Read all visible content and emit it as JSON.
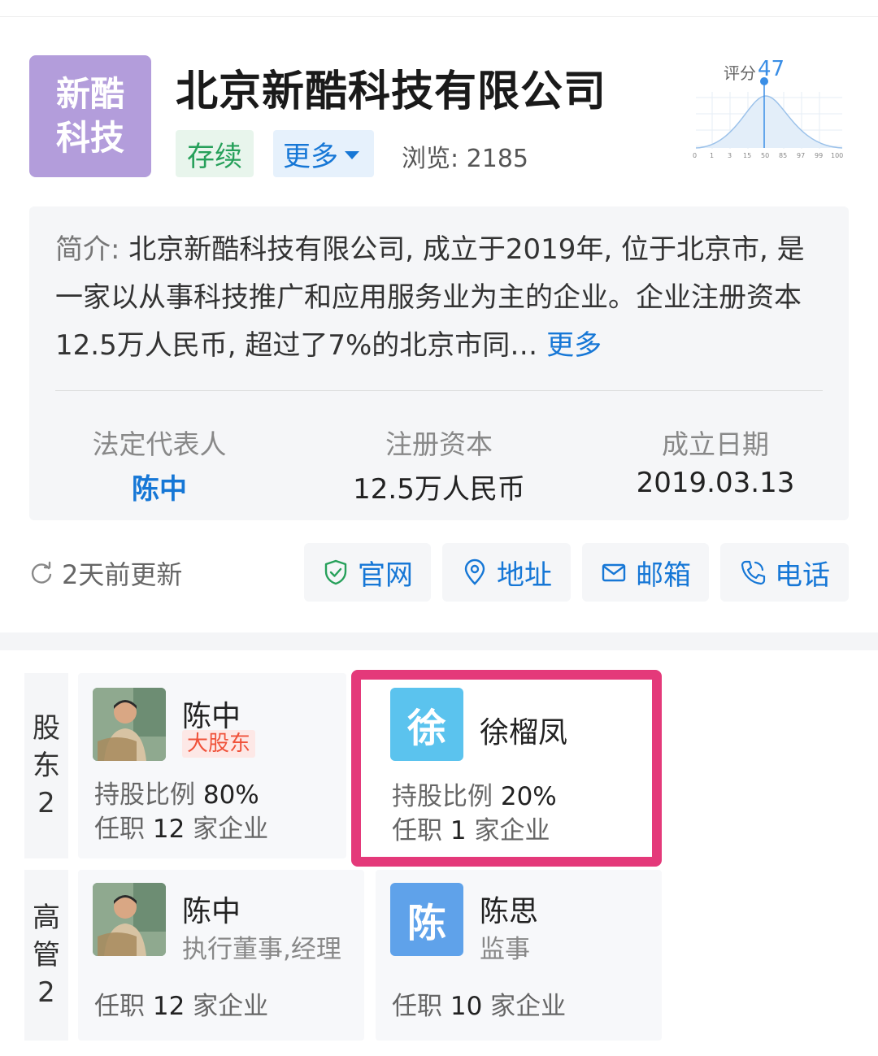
{
  "header": {
    "logo_lines": [
      "新酷",
      "科技"
    ],
    "company_name": "北京新酷科技有限公司",
    "status_tag": "存续",
    "more_label": "更多",
    "views": "浏览: 2185",
    "score_label": "评分",
    "score_value": "47",
    "score_axis": [
      "0",
      "1",
      "3",
      "15",
      "50",
      "85",
      "97",
      "99",
      "100"
    ]
  },
  "intro": {
    "label": "简介:",
    "text": "北京新酷科技有限公司, 成立于2019年, 位于北京市, 是一家以从事科技推广和应用服务业为主的企业。企业注册资本12.5万人民币, 超过了7%的北京市同…",
    "more": "更多",
    "legal_rep_label": "法定代表人",
    "legal_rep_value": "陈中",
    "capital_label": "注册资本",
    "capital_value": "12.5万人民币",
    "date_label": "成立日期",
    "date_value": "2019.03.13"
  },
  "actions": {
    "update": "2天前更新",
    "website": "官网",
    "address": "地址",
    "email": "邮箱",
    "phone": "电话"
  },
  "shareholders": {
    "label_chars": [
      "股",
      "东",
      "2"
    ],
    "items": [
      {
        "name": "陈中",
        "badge": "大股东",
        "ratio_label": "持股比例",
        "ratio": "80%",
        "jobs_prefix": "任职",
        "jobs": "12",
        "jobs_suffix": "家企业"
      },
      {
        "name": "徐榴凤",
        "avatar_letter": "徐",
        "ratio_label": "持股比例",
        "ratio": "20%",
        "jobs_prefix": "任职",
        "jobs": "1",
        "jobs_suffix": "家企业"
      }
    ]
  },
  "executives": {
    "label_chars": [
      "高",
      "管",
      "2"
    ],
    "items": [
      {
        "name": "陈中",
        "role": "执行董事,经理",
        "jobs_prefix": "任职",
        "jobs": "12",
        "jobs_suffix": "家企业"
      },
      {
        "name": "陈思",
        "avatar_letter": "陈",
        "role": "监事",
        "jobs_prefix": "任职",
        "jobs": "10",
        "jobs_suffix": "家企业"
      }
    ]
  },
  "colors": {
    "accent": "#1677d6",
    "logo_bg": "#b39ddb",
    "highlight": "#e4397a",
    "status_green": "#26a05a"
  }
}
